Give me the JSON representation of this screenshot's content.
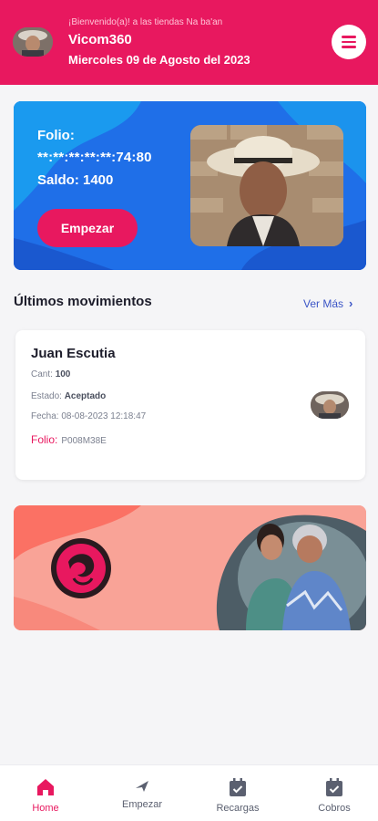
{
  "header": {
    "welcome": "¡Bienvenido(a)! a las tiendas Na ba'an",
    "user_name": "Vicom360",
    "date": "Miercoles 09 de Agosto del 2023"
  },
  "card": {
    "folio_label": "Folio:",
    "folio_value": "**:**:**:**:**:74:80",
    "saldo": "Saldo: 1400",
    "start_label": "Empezar"
  },
  "movements": {
    "title": "Últimos movimientos",
    "see_more": "Ver Más",
    "item": {
      "name": "Juan Escutia",
      "cant_label": "Cant:",
      "cant_value": "100",
      "estado_label": "Estado:",
      "estado_value": "Aceptado",
      "fecha": "Fecha: 08-08-2023 12:18:47",
      "folio_label": "Folio:",
      "folio_value": "P008M38E"
    }
  },
  "colors": {
    "brand": "#e8185f",
    "card_blue": "#1f6fe8",
    "link": "#3b55c6",
    "promo": "#f9a397"
  },
  "nav": [
    {
      "label": "Home",
      "icon": "home-icon",
      "active": true
    },
    {
      "label": "Empezar",
      "icon": "send-icon",
      "active": false
    },
    {
      "label": "Recargas",
      "icon": "calendar-check-icon",
      "active": false
    },
    {
      "label": "Cobros",
      "icon": "calendar-check-icon",
      "active": false
    }
  ]
}
